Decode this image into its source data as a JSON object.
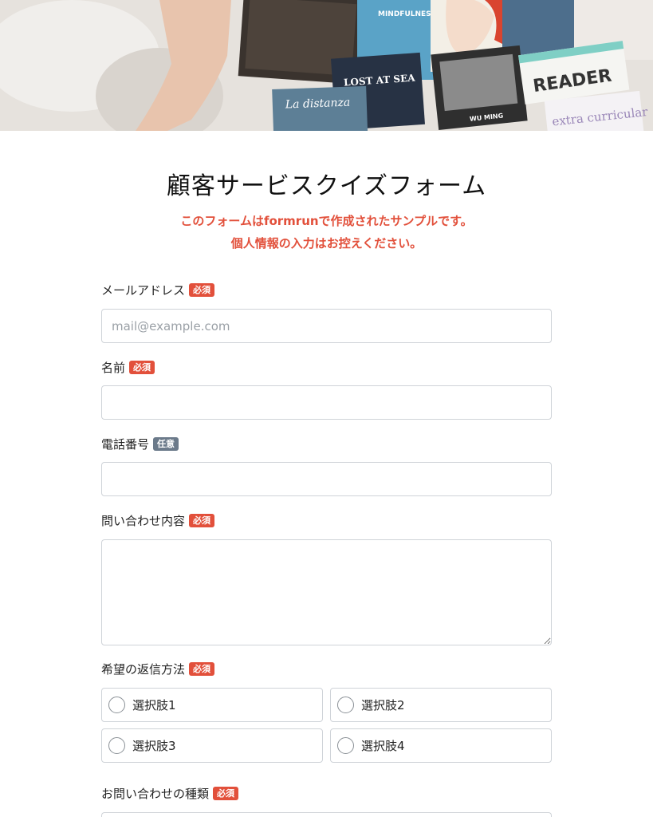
{
  "header": {
    "cover_texts": [
      "MINDFULNESS",
      "LOST AT SEA",
      "La distanza",
      "READER",
      "extra curricular",
      "WU MING"
    ]
  },
  "form": {
    "title": "顧客サービスクイズフォーム",
    "notice_line1": "このフォームはformrunで作成されたサンプルです。",
    "notice_line2": "個人情報の入力はお控えください。"
  },
  "fields": {
    "email": {
      "label": "メールアドレス",
      "badge": "必須",
      "placeholder": "mail@example.com",
      "value": ""
    },
    "name": {
      "label": "名前",
      "badge": "必須",
      "value": ""
    },
    "phone": {
      "label": "電話番号",
      "badge": "任意",
      "value": ""
    },
    "inquiry": {
      "label": "問い合わせ内容",
      "badge": "必須",
      "value": ""
    },
    "reply_method": {
      "label": "希望の返信方法",
      "badge": "必須",
      "options": [
        "選択肢1",
        "選択肢2",
        "選択肢3",
        "選択肢4"
      ]
    },
    "inquiry_type": {
      "label": "お問い合わせの種類",
      "badge": "必須"
    }
  },
  "colors": {
    "required_badge": "#e2503b",
    "optional_badge": "#6b7a8a",
    "notice": "#e2503b"
  }
}
